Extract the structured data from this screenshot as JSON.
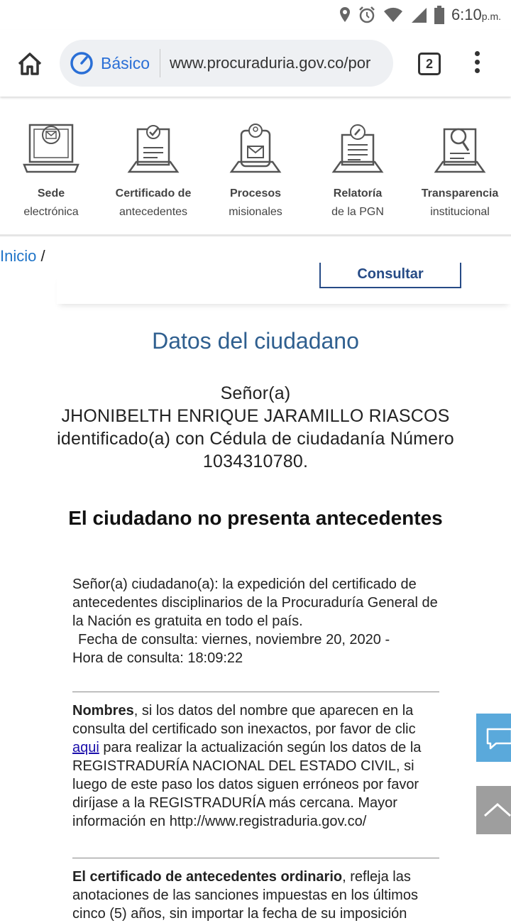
{
  "status": {
    "time": "6:10",
    "ampm": "p.m."
  },
  "browser": {
    "mode_label": "Básico",
    "url": "www.procuraduria.gov.co/por",
    "tab_count": "2"
  },
  "quicknav": [
    {
      "bold": "Sede",
      "sub": "electrónica"
    },
    {
      "bold": "Certificado de",
      "sub": "antecedentes"
    },
    {
      "bold": "Procesos",
      "sub": "misionales"
    },
    {
      "bold": "Relatoría",
      "sub": "de la PGN"
    },
    {
      "bold": "Transparencia",
      "sub": "institucional"
    }
  ],
  "breadcrumb": {
    "home": "Inicio",
    "sep": "/"
  },
  "form": {
    "consultar_label": "Consultar"
  },
  "result": {
    "title": "Datos del ciudadano",
    "salutation": "Señor(a)",
    "name": "JHONIBELTH ENRIQUE JARAMILLO RIASCOS",
    "id_line": "identificado(a) con Cédula de ciudadanía Número 1034310780.",
    "headline": "El ciudadano no presenta antecedentes",
    "info": "Señor(a) ciudadano(a): la expedición del certificado de antecedentes disciplinarios de la Procuraduría General de la Nación es gratuita en todo el país.",
    "fecha": "Fecha de consulta: viernes, noviembre 20, 2020 -",
    "hora": "Hora de consulta: 18:09:22"
  },
  "nombres": {
    "bold": "Nombres",
    "text1": ", si los datos del nombre que aparecen en la consulta del certificado son inexactos, por favor de clic ",
    "link": "aqui",
    "text2": " para realizar la actualización según los datos de la REGISTRADURÍA NACIONAL DEL ESTADO CIVIL, si luego de este paso los datos siguen erróneos por favor diríjase a la REGISTRADURÍA más cercana. Mayor información en http://www.registraduria.gov.co/"
  },
  "ordinario": {
    "bold": "El certificado de antecedentes ordinario",
    "text": ", refleja las anotaciones de las sanciones impuestas en los últimos cinco (5) años, sin importar la fecha de su imposición"
  },
  "icons": [
    "location-icon",
    "alarm-icon",
    "wifi-icon",
    "signal-icon",
    "battery-icon",
    "home-icon",
    "speed-icon",
    "menu-icon",
    "chat-icon",
    "chevron-up-icon"
  ]
}
